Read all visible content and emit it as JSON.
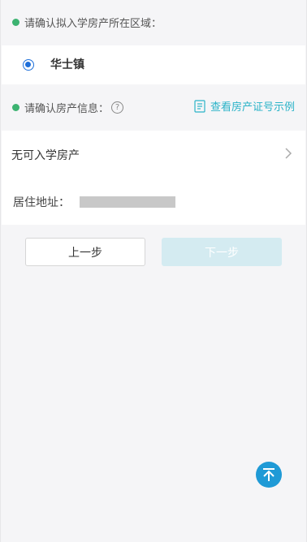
{
  "region": {
    "title": "请确认拟入学房产所在区域：",
    "selected": "华士镇"
  },
  "property": {
    "title": "请确认房产信息：",
    "help_glyph": "?",
    "sample_link": "查看房产证号示例",
    "no_property_label": "无可入学房产",
    "address_label": "居住地址："
  },
  "actions": {
    "prev_label": "上一步",
    "next_label": "下一步"
  },
  "colors": {
    "accent_green": "#3cb371",
    "link_teal": "#2bb3c8",
    "radio_blue": "#1e6fd9",
    "scroll_top_blue": "#1f9ad6",
    "disabled_button": "#d4ebf1"
  },
  "icons": [
    "status-dot-icon",
    "radio-selected-icon",
    "help-icon",
    "document-icon",
    "chevron-right-icon",
    "scroll-top-icon"
  ]
}
